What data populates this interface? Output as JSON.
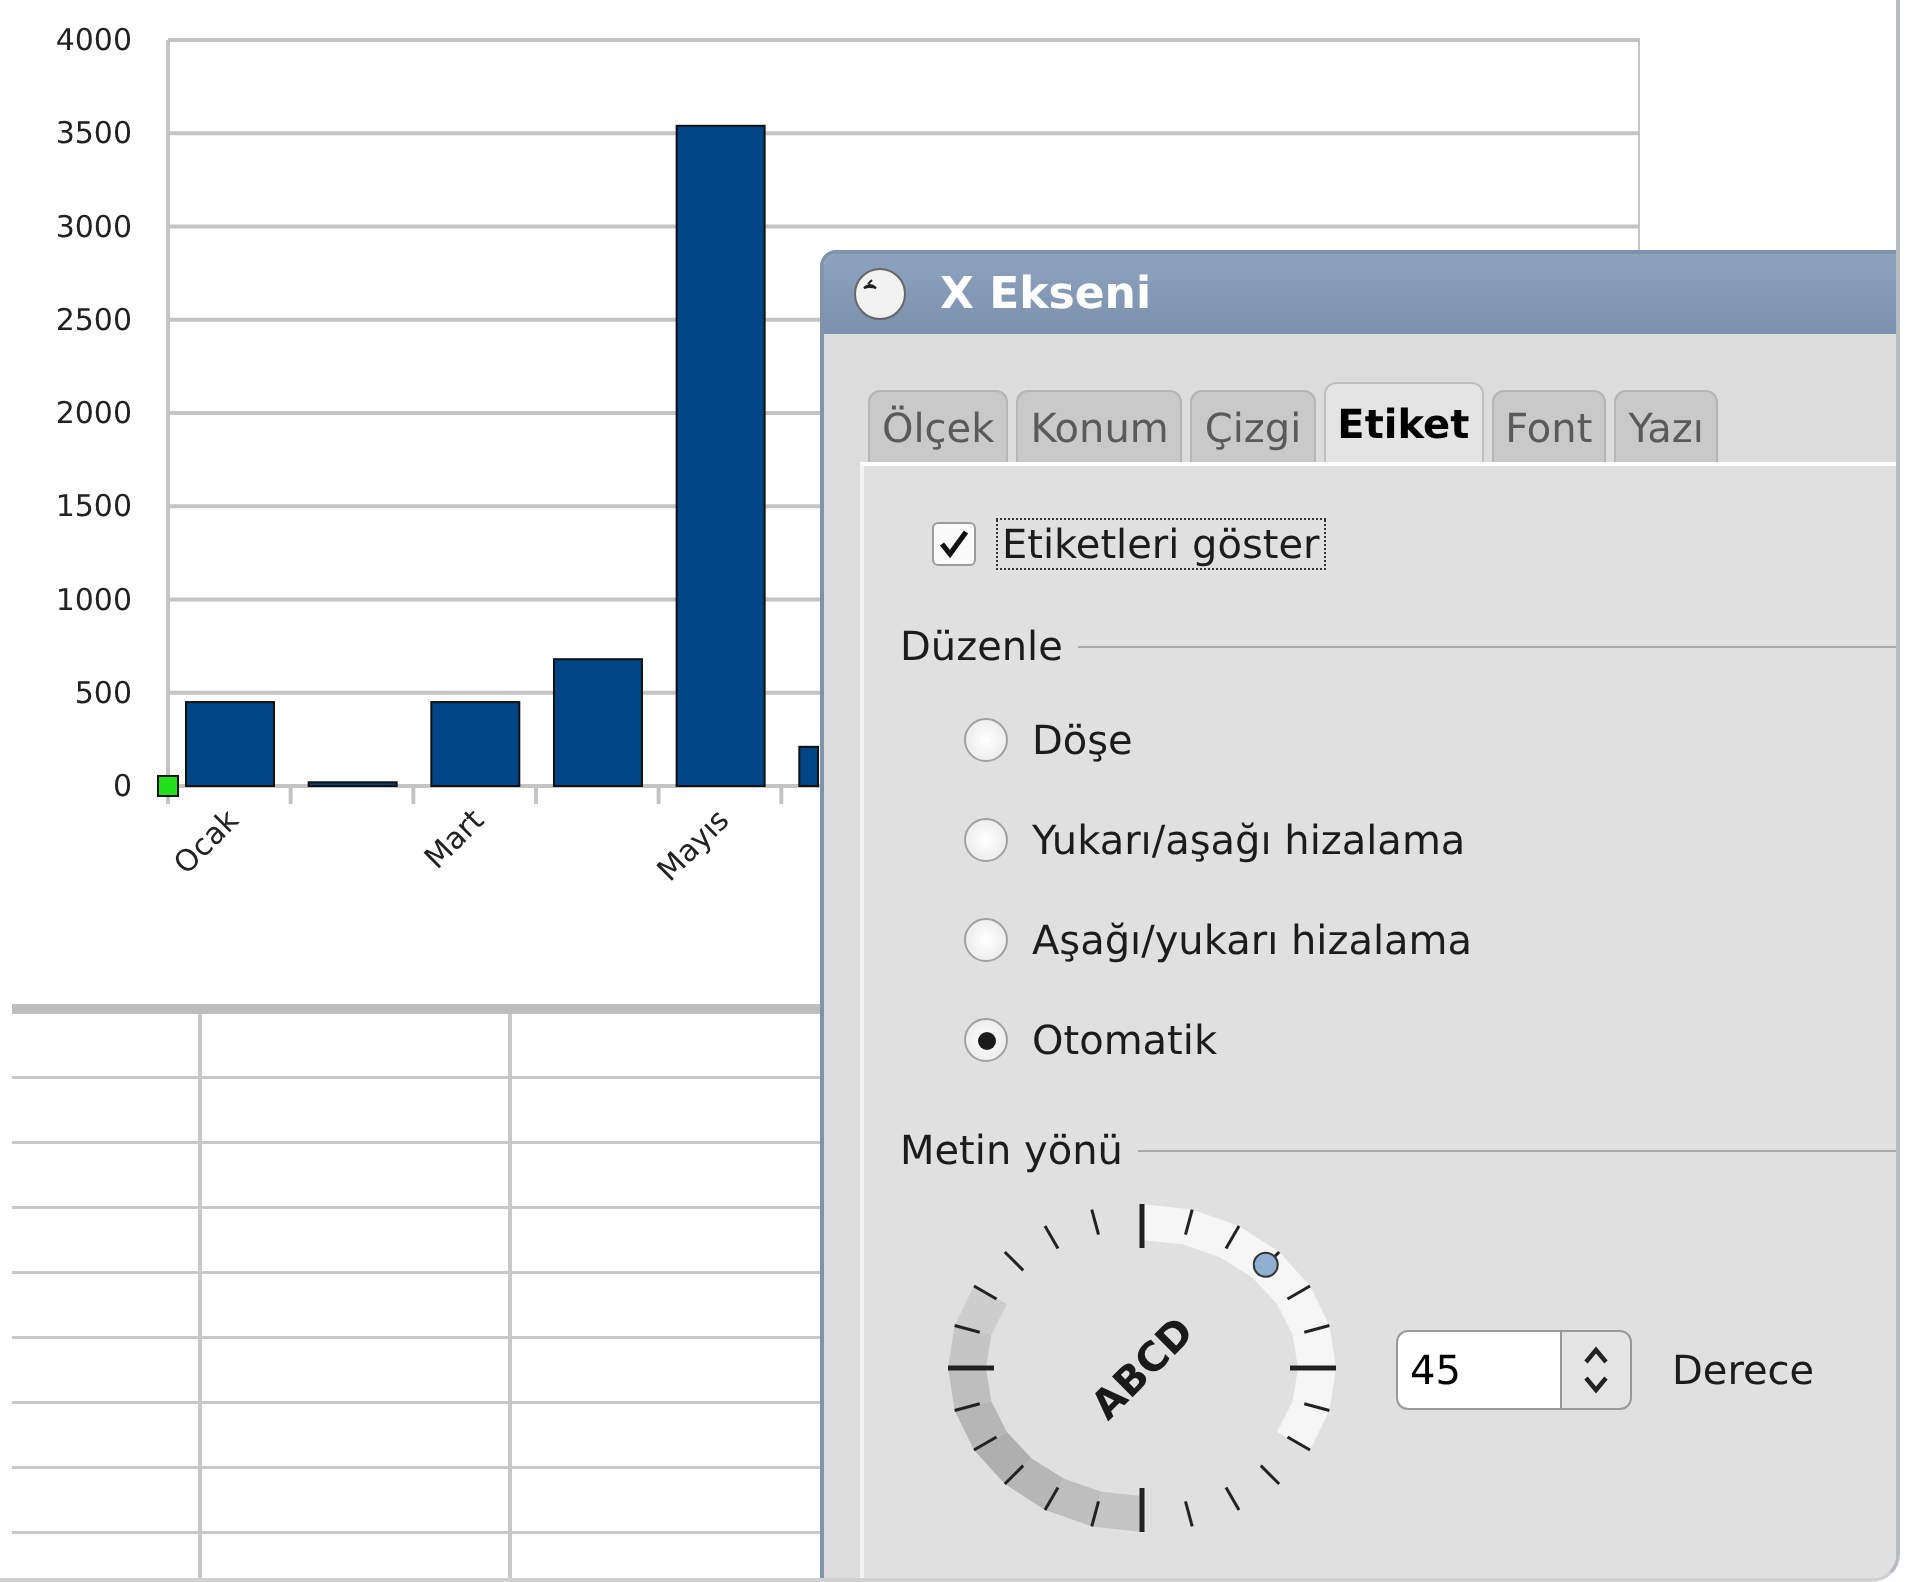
{
  "chart": {
    "chart_data": {
      "type": "bar",
      "categories": [
        "Ocak",
        null,
        "Mart",
        null,
        "Mayıs",
        null
      ],
      "series": [
        {
          "color": "#004586",
          "values": [
            450,
            20,
            450,
            680,
            3540,
            210
          ]
        }
      ],
      "grid": true,
      "ylim": [
        0,
        4000
      ],
      "yticks": [
        0,
        500,
        1000,
        1500,
        2000,
        2500,
        3000,
        3500,
        4000
      ]
    }
  },
  "dialog": {
    "title": "X Ekseni",
    "tabs": [
      {
        "label": "Ölçek",
        "selected": false
      },
      {
        "label": "Konum",
        "selected": false
      },
      {
        "label": "Çizgi",
        "selected": false
      },
      {
        "label": "Etiket",
        "selected": true
      },
      {
        "label": "Font",
        "selected": false
      },
      {
        "label": "Yazı",
        "selected": false
      }
    ],
    "show_labels": {
      "label": "Etiketleri göster",
      "checked": true
    },
    "arrange": {
      "heading": "Düzenle",
      "options": [
        {
          "label": "Döşe",
          "selected": false
        },
        {
          "label": "Yukarı/aşağı hizalama",
          "selected": false
        },
        {
          "label": "Aşağı/yukarı hizalama",
          "selected": false
        },
        {
          "label": "Otomatik",
          "selected": true
        }
      ]
    },
    "text_direction": {
      "heading": "Metin yönü",
      "dial_label": "ABCD",
      "value": "45",
      "unit_label": "Derece"
    }
  }
}
